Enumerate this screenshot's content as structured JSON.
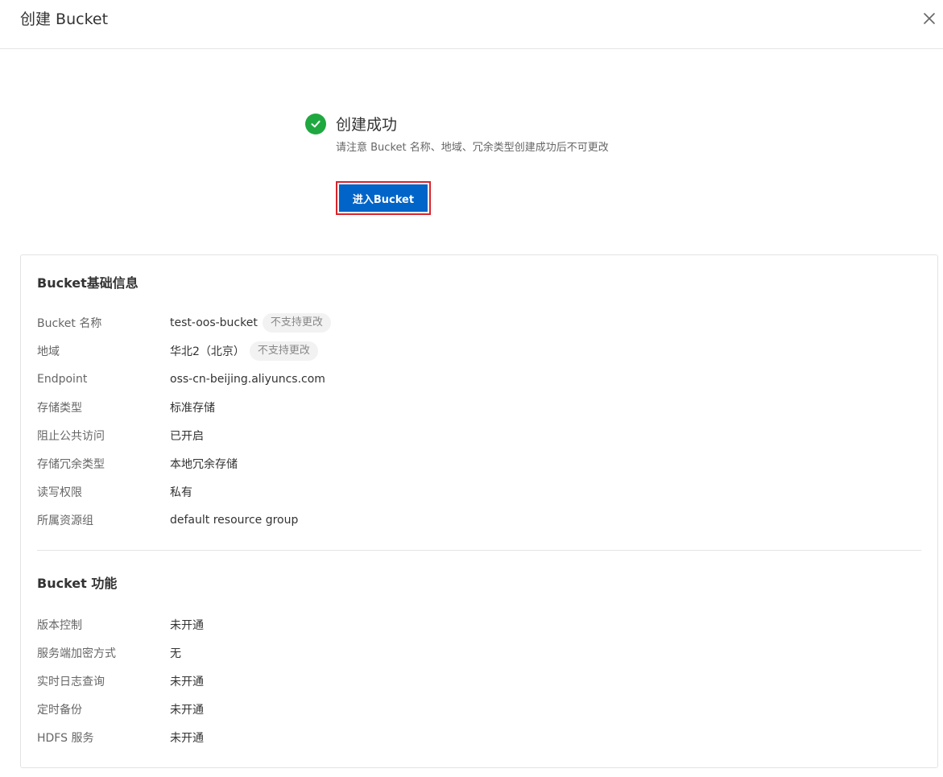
{
  "dialog": {
    "title": "创建 Bucket"
  },
  "success": {
    "title": "创建成功",
    "description": "请注意 Bucket 名称、地域、冗余类型创建成功后不可更改",
    "button_label": "进入Bucket"
  },
  "basic_info": {
    "title": "Bucket基础信息",
    "rows": [
      {
        "label": "Bucket 名称",
        "value": "test-oos-bucket",
        "tag": "不支持更改"
      },
      {
        "label": "地域",
        "value": "华北2（北京）",
        "tag": "不支持更改"
      },
      {
        "label": "Endpoint",
        "value": "oss-cn-beijing.aliyuncs.com"
      },
      {
        "label": "存储类型",
        "value": "标准存储"
      },
      {
        "label": "阻止公共访问",
        "value": "已开启"
      },
      {
        "label": "存储冗余类型",
        "value": "本地冗余存储"
      },
      {
        "label": "读写权限",
        "value": "私有"
      },
      {
        "label": "所属资源组",
        "value": "default resource group"
      }
    ]
  },
  "features": {
    "title": "Bucket 功能",
    "rows": [
      {
        "label": "版本控制",
        "value": "未开通"
      },
      {
        "label": "服务端加密方式",
        "value": "无"
      },
      {
        "label": "实时日志查询",
        "value": "未开通"
      },
      {
        "label": "定时备份",
        "value": "未开通"
      },
      {
        "label": "HDFS 服务",
        "value": "未开通"
      }
    ]
  },
  "colors": {
    "primary": "#0064c8",
    "success": "#1fa83f",
    "highlight": "#d9242c"
  },
  "icons": {
    "close": "close-icon",
    "success": "check-circle-icon"
  }
}
